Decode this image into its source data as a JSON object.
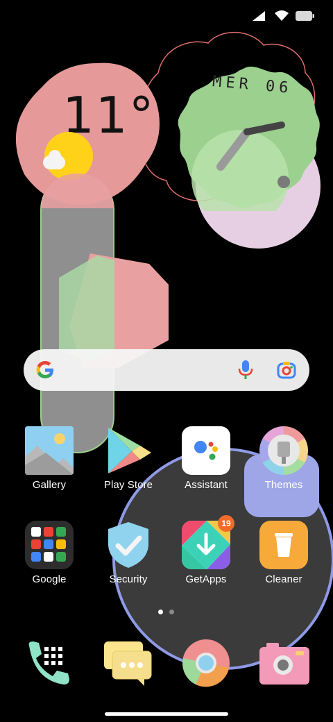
{
  "status_bar": {
    "signal_icon": "cell-signal-icon",
    "wifi_icon": "wifi-icon",
    "battery_icon": "battery-icon"
  },
  "weather_widget": {
    "temperature": "11°",
    "condition_icon": "partly-sunny-icon"
  },
  "clock_widget": {
    "date": "MER 06"
  },
  "search_bar": {
    "logo": "G",
    "mic_icon": "mic-icon",
    "lens_icon": "camera-lens-icon"
  },
  "apps": [
    {
      "label": "Gallery",
      "icon": "gallery-icon"
    },
    {
      "label": "Play Store",
      "icon": "play-store-icon"
    },
    {
      "label": "Assistant",
      "icon": "assistant-icon"
    },
    {
      "label": "Themes",
      "icon": "themes-icon"
    },
    {
      "label": "Google",
      "icon": "google-folder-icon"
    },
    {
      "label": "Security",
      "icon": "security-icon"
    },
    {
      "label": "GetApps",
      "icon": "getapps-icon",
      "badge": "19"
    },
    {
      "label": "Cleaner",
      "icon": "cleaner-icon"
    }
  ],
  "page_indicator": {
    "pages": 2,
    "current": 1
  },
  "dock": [
    {
      "icon": "phone-icon"
    },
    {
      "icon": "messages-icon"
    },
    {
      "icon": "chrome-icon"
    },
    {
      "icon": "camera-icon"
    }
  ],
  "colors": {
    "accent_purple": "#8f9ae6",
    "weather_pink": "#e59a99",
    "clock_green": "#9bd08f",
    "badge": "#f26b2a"
  }
}
